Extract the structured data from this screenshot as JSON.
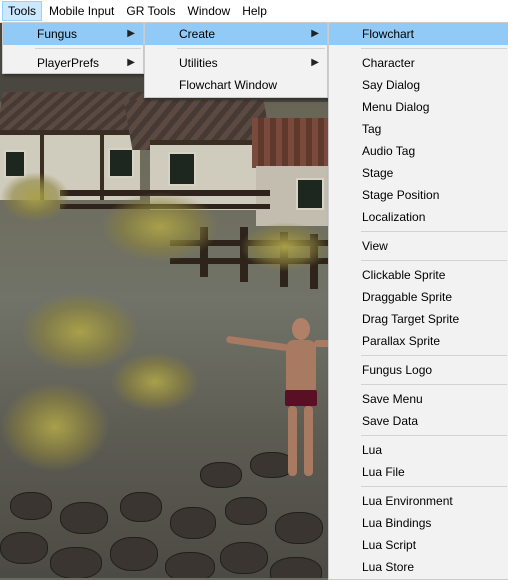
{
  "menubar": {
    "items": [
      "Tools",
      "Mobile Input",
      "GR Tools",
      "Window",
      "Help"
    ],
    "active": "Tools"
  },
  "tools_menu": {
    "items": [
      {
        "label": "Fungus",
        "submenu": true,
        "highlighted": true
      },
      {
        "label": "PlayerPrefs",
        "submenu": true,
        "highlighted": false
      }
    ]
  },
  "fungus_menu": {
    "items": [
      {
        "label": "Create",
        "submenu": true,
        "highlighted": true
      },
      {
        "label": "Utilities",
        "submenu": true,
        "highlighted": false
      },
      {
        "label": "Flowchart Window",
        "submenu": false,
        "highlighted": false
      }
    ]
  },
  "create_menu": {
    "groups": [
      [
        "Flowchart"
      ],
      [
        "Character",
        "Say Dialog",
        "Menu Dialog",
        "Tag",
        "Audio Tag",
        "Stage",
        "Stage Position",
        "Localization"
      ],
      [
        "View"
      ],
      [
        "Clickable Sprite",
        "Draggable Sprite",
        "Drag Target Sprite",
        "Parallax Sprite"
      ],
      [
        "Fungus Logo"
      ],
      [
        "Save Menu",
        "Save Data"
      ],
      [
        "Lua",
        "Lua File"
      ],
      [
        "Lua Environment",
        "Lua Bindings",
        "Lua Script",
        "Lua Store"
      ]
    ],
    "highlighted": "Flowchart"
  },
  "colors": {
    "menubar_active_bg": "#cce8ff",
    "menu_highlight_bg": "#91c9f7",
    "menu_bg": "#f2f2f2"
  },
  "icons": {
    "submenu_arrow": "chevron-right-icon"
  }
}
